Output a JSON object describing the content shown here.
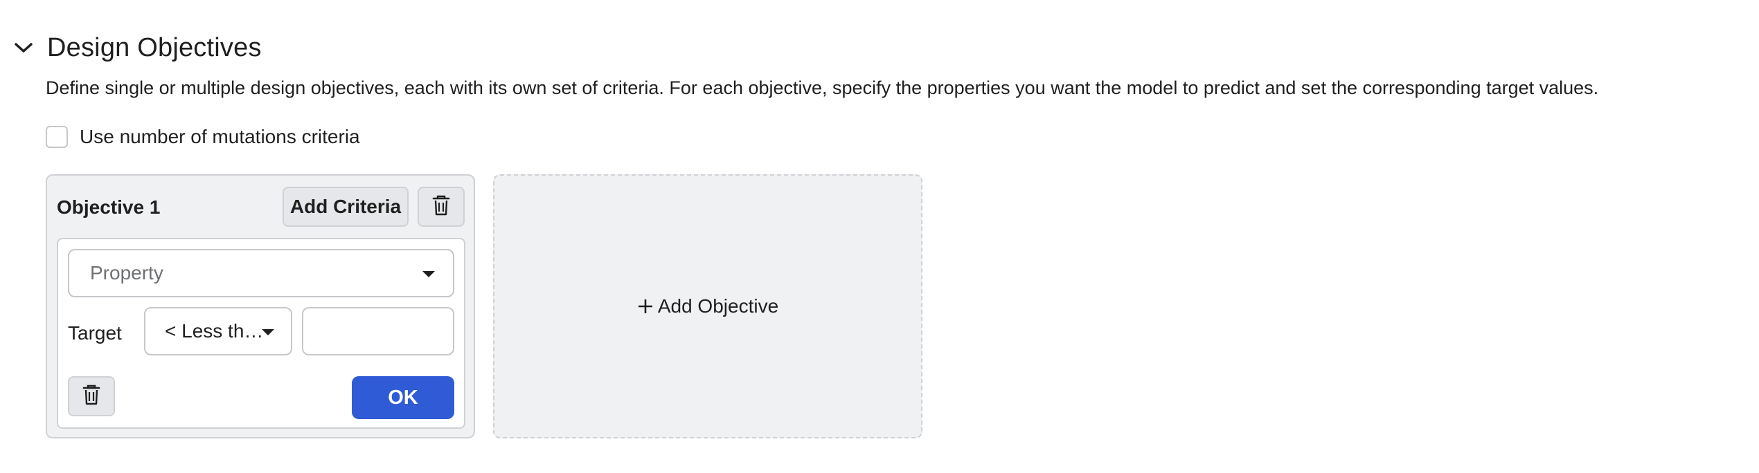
{
  "section": {
    "title": "Design Objectives",
    "description": "Define single or multiple design objectives, each with its own set of criteria. For each objective, specify the properties you want the model to predict and set the corresponding target values.",
    "toggle_icon": "chevron-down-icon"
  },
  "mutations": {
    "label": "Use number of mutations criteria",
    "checked": false
  },
  "objectives": [
    {
      "title": "Objective 1",
      "add_criteria_label": "Add Criteria",
      "delete_icon": "trash-icon",
      "criteria": [
        {
          "property_placeholder": "Property",
          "target_label": "Target",
          "comparator": "< Less th…",
          "target_value": "",
          "ok_label": "OK",
          "delete_icon": "trash-icon"
        }
      ]
    }
  ],
  "add_objective": {
    "label": "Add Objective",
    "icon": "plus-icon"
  },
  "colors": {
    "primary": "#2f5bd6",
    "card_bg": "#f0f1f3",
    "border": "#cfd1d5"
  }
}
